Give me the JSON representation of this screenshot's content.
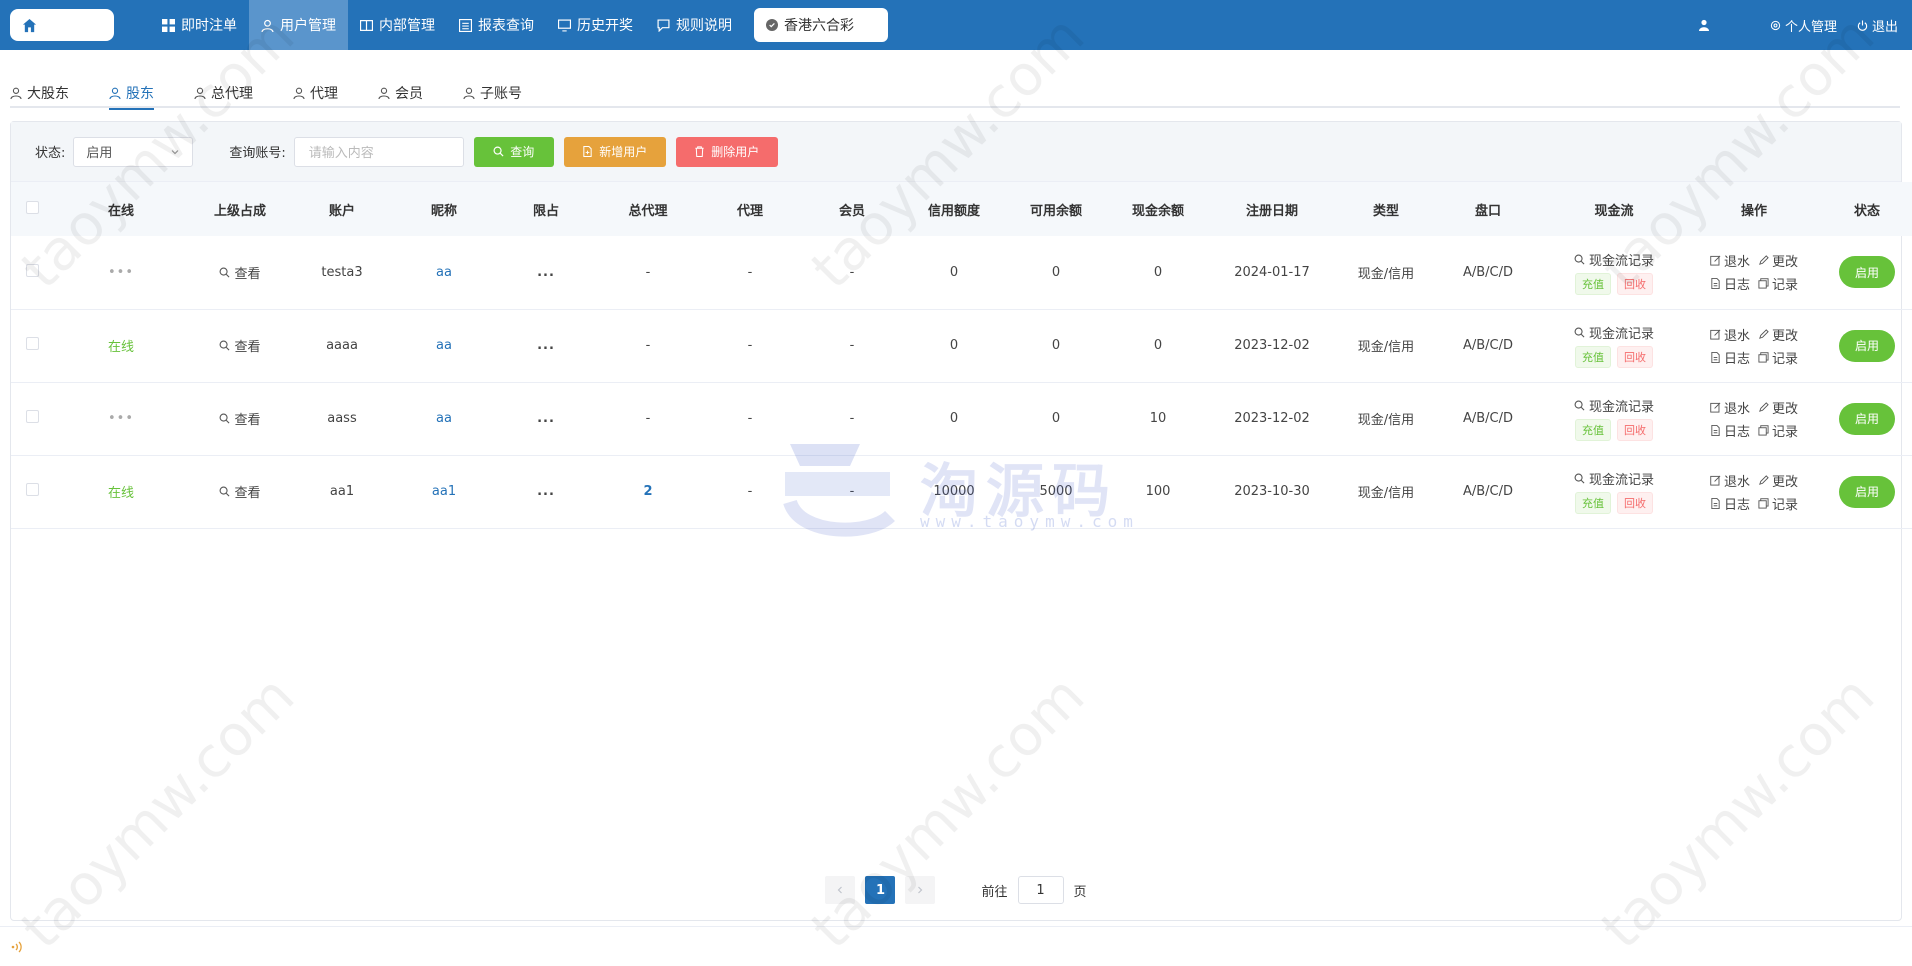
{
  "nav": {
    "items": [
      {
        "label": "即时注单",
        "icon": "grid-icon"
      },
      {
        "label": "用户管理",
        "icon": "user-icon",
        "active": true
      },
      {
        "label": "内部管理",
        "icon": "book-icon"
      },
      {
        "label": "报表查询",
        "icon": "list-icon"
      },
      {
        "label": "历史开奖",
        "icon": "monitor-icon"
      },
      {
        "label": "规则说明",
        "icon": "chat-icon"
      }
    ],
    "lottery": "香港六合彩",
    "personal": "个人管理",
    "logout": "退出"
  },
  "tabs": [
    "大股东",
    "股东",
    "总代理",
    "代理",
    "会员",
    "子账号"
  ],
  "active_tab": 1,
  "filter": {
    "status_label": "状态:",
    "status_value": "启用",
    "query_label": "查询账号:",
    "query_placeholder": "请输入内容",
    "search_btn": "查询",
    "add_btn": "新增用户",
    "delete_btn": "删除用户"
  },
  "table": {
    "headers": [
      "在线",
      "上级占成",
      "账户",
      "昵称",
      "限占",
      "总代理",
      "代理",
      "会员",
      "信用额度",
      "可用余额",
      "现金余额",
      "注册日期",
      "类型",
      "盘口",
      "现金流",
      "操作",
      "状态"
    ],
    "rows": [
      {
        "online": "•••",
        "superior": "查看",
        "account": "testa3",
        "nickname": "aa",
        "limit": "...",
        "general_agent": "-",
        "agent": "-",
        "member": "-",
        "credit": "0",
        "available": "0",
        "cash": "0",
        "date": "2024-01-17",
        "type": "现金/信用",
        "market": "A/B/C/D",
        "status": "启用"
      },
      {
        "online": "在线",
        "superior": "查看",
        "account": "aaaa",
        "nickname": "aa",
        "limit": "...",
        "general_agent": "-",
        "agent": "-",
        "member": "-",
        "credit": "0",
        "available": "0",
        "cash": "0",
        "date": "2023-12-02",
        "type": "现金/信用",
        "market": "A/B/C/D",
        "status": "启用"
      },
      {
        "online": "•••",
        "superior": "查看",
        "account": "aass",
        "nickname": "aa",
        "limit": "...",
        "general_agent": "-",
        "agent": "-",
        "member": "-",
        "credit": "0",
        "available": "0",
        "cash": "10",
        "date": "2023-12-02",
        "type": "现金/信用",
        "market": "A/B/C/D",
        "status": "启用"
      },
      {
        "online": "在线",
        "superior": "查看",
        "account": "aa1",
        "nickname": "aa1",
        "limit": "...",
        "general_agent": "2",
        "agent": "-",
        "member": "-",
        "credit": "10000",
        "available": "5000",
        "cash": "100",
        "date": "2023-10-30",
        "type": "现金/信用",
        "market": "A/B/C/D",
        "status": "启用"
      }
    ],
    "cashflow_link": "现金流记录",
    "recharge": "充值",
    "recover": "回收",
    "ops": [
      "退水",
      "更改",
      "日志",
      "记录"
    ]
  },
  "pager": {
    "current": "1",
    "goto_label": "前往",
    "goto_value": "1",
    "page_suffix": "页"
  },
  "watermark": "taoymw.com",
  "brand": {
    "name": "淘源码",
    "url": "www.taoymw.com"
  },
  "colors": {
    "primary": "#2472b8",
    "success": "#67c23a",
    "warning": "#e6a23c",
    "danger": "#f56c6c"
  }
}
